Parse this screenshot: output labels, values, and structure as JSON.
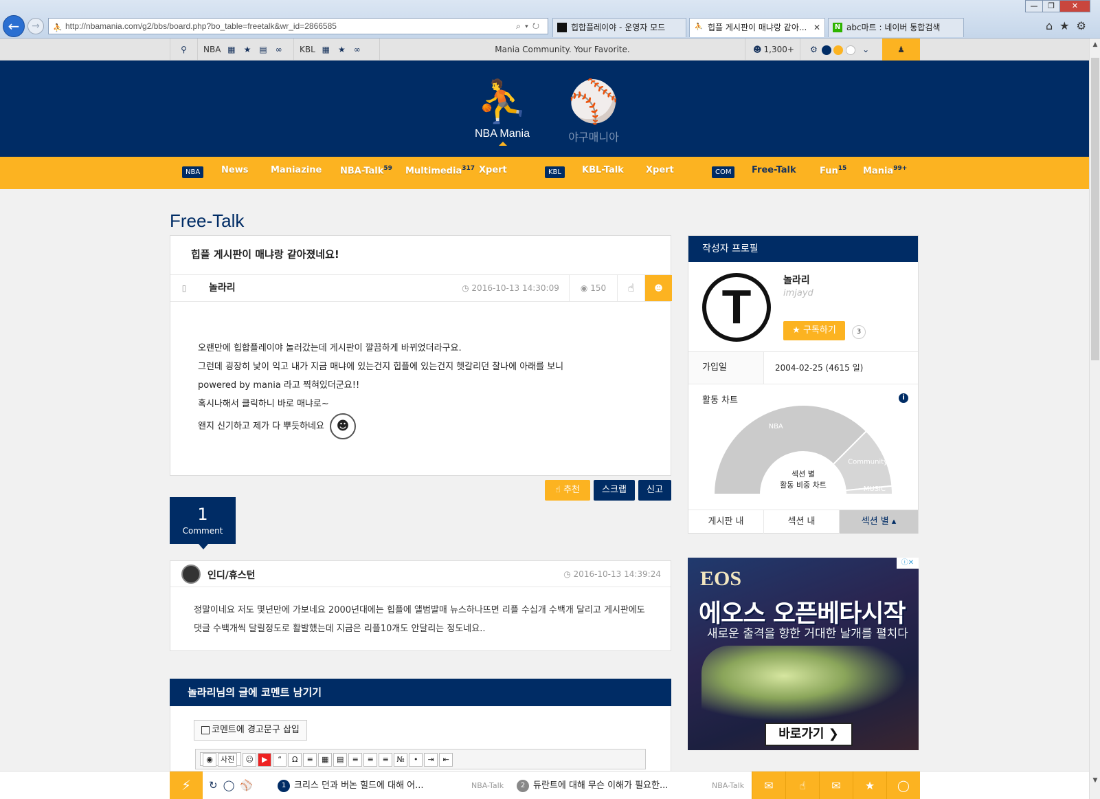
{
  "browser": {
    "url": "http://nbamania.com/g2/bbs/board.php?bo_table=freetalk&wr_id=2866585",
    "tabs": [
      {
        "label": "힙합플레이야 - 운영자 모드",
        "active": false
      },
      {
        "label": "힙플 게시판이 매냐랑 같아...",
        "active": true
      },
      {
        "label": "abc마트 : 네이버 통합검색",
        "active": false
      }
    ]
  },
  "topbar": {
    "nba_label": "NBA",
    "kbl_label": "KBL",
    "slogan": "Mania Community. Your Favorite.",
    "online_count": "1,300+"
  },
  "header": {
    "logo_nba": "NBA Mania",
    "logo_baseball": "야구매니아"
  },
  "nav": {
    "badge_nba": "NBA",
    "news": "News",
    "maniazine": "Maniazine",
    "nba_talk": "NBA-Talk",
    "nba_talk_count": "59",
    "multimedia": "Multimedia",
    "multimedia_count": "317",
    "xpert": "Xpert",
    "badge_kbl": "KBL",
    "kbl_talk": "KBL-Talk",
    "kbl_xpert": "Xpert",
    "badge_com": "COM",
    "free_talk": "Free-Talk",
    "fun": "Fun",
    "fun_count": "15",
    "mania": "Mania",
    "mania_count": "99+"
  },
  "page": {
    "title": "Free-Talk"
  },
  "post": {
    "title": "힙플 게시판이 매냐랑 같아졌네요!",
    "author": "놀라리",
    "date": "2016-10-13 14:30:09",
    "views": "150",
    "body": [
      "오랜만에 힙합플레이야 놀러갔는데 게시판이 깔끔하게 바뀌었더라구요.",
      "그런데 굉장히 낯이 익고 내가 지금 매냐에 있는건지 힙플에 있는건지 헷갈리던 찰나에 아래를 보니",
      "powered by mania 라고 찍혀있더군요!!",
      "혹시나해서 클릭하니 바로 매냐로~",
      "왠지 신기하고 제가 다 뿌듯하네요"
    ]
  },
  "actions": {
    "recommend": "추천",
    "scrap": "스크랩",
    "report": "신고"
  },
  "comments": {
    "count": "1",
    "count_label": "Comment",
    "items": [
      {
        "author": "인디/휴스턴",
        "date": "2016-10-13 14:39:24",
        "body": "정말이네요 저도 몇년만에 가보네요 2000년대에는 힙플에 앨범발매 뉴스하나뜨면 리플 수십개 수백개 달리고 게시판에도 댓글 수백개씩 달릴정도로 활발했는데 지금은 리플10개도 안달리는 정도네요.."
      }
    ]
  },
  "write": {
    "header": "놀라리님의 글에 코멘트 남기기",
    "warning_checkbox": "코멘트에 경고문구 삽입",
    "toolbar_photo": "사진"
  },
  "profile": {
    "header": "작성자 프로필",
    "name": "놀라리",
    "id": "imjayd",
    "subscribe": "구독하기",
    "subscribe_count": "3",
    "join_label": "가입일",
    "join_value": "2004-02-25 (4615 일)",
    "activity_label": "활동 차트",
    "chart_center_line1": "섹션 별",
    "chart_center_line2": "활동 비중 차트",
    "tabs": [
      "게시판 내",
      "섹션 내",
      "섹션 별"
    ]
  },
  "chart_data": {
    "type": "pie",
    "categories": [
      "NBA",
      "Community",
      "MUSIC"
    ],
    "values": [
      75,
      22,
      3
    ]
  },
  "ad": {
    "logo": "EOS",
    "title": "에오스 오픈베타시작",
    "subtitle": "새로운 출격을 향한 거대한 날개를 펼치다",
    "cta": "바로가기 ❯"
  },
  "bottombar": {
    "items": [
      {
        "num": "1",
        "title": "크리스 던과 버논 힐드에 대해 어...",
        "category": "NBA-Talk"
      },
      {
        "num": "2",
        "title": "듀란트에 대해 무슨 이해가 필요한...",
        "category": "NBA-Talk"
      }
    ]
  },
  "colors": {
    "navy": "#002c65",
    "accent": "#fcb321"
  }
}
